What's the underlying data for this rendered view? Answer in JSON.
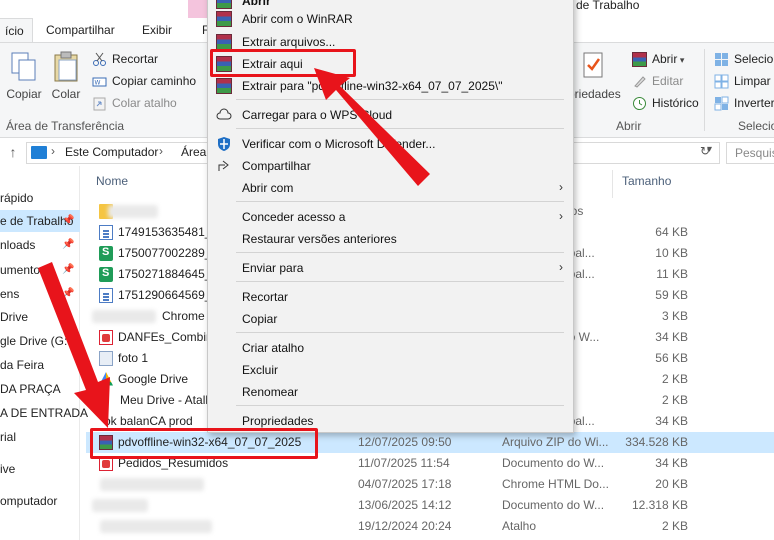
{
  "window": {
    "title": "a de Trabalho"
  },
  "tabs": [
    {
      "label": "ício"
    },
    {
      "label": "Compartilhar"
    },
    {
      "label": "Exibir"
    },
    {
      "label": "F"
    }
  ],
  "ribbon": {
    "copy_label": "Copiar",
    "paste_label": "Colar",
    "cut_label": "Recortar",
    "copy_path_label": "Copiar caminho",
    "paste_shortcut_label": "Colar atalho",
    "group_clipboard": "Área de Transferência",
    "properties_label": "priedades",
    "open_label": "Abrir",
    "edit_label": "Editar",
    "history_label": "Histórico",
    "group_open": "Abrir",
    "select_all_label": "Selecio",
    "clear_selection_label": "Limpar s",
    "invert_label": "Inverter",
    "group_select": "Selecio"
  },
  "address": {
    "path_root": "Este Computador",
    "path_next": "Área",
    "search_placeholder": "Pesquis"
  },
  "nav_pane": {
    "items": [
      {
        "label": " rápido"
      },
      {
        "label": "e de Trabalho"
      },
      {
        "label": "nloads"
      },
      {
        "label": "umentos"
      },
      {
        "label": "ens"
      },
      {
        "label": "Drive"
      },
      {
        "label": "gle Drive (G:"
      },
      {
        "label": "da Feira"
      },
      {
        "label": " DA PRAÇA"
      },
      {
        "label": "A DE ENTRADA"
      },
      {
        "label": "rial"
      },
      {
        "label": "ive"
      },
      {
        "label": "omputador"
      }
    ]
  },
  "columns": {
    "name": "Nome",
    "size": "Tamanho"
  },
  "files": [
    {
      "name": "",
      "date": "",
      "type": "ivos",
      "size": "",
      "icon": "folder-icon"
    },
    {
      "name": "1749153635481_6",
      "date": "",
      "type": "",
      "size": "64 KB",
      "icon": "document-icon"
    },
    {
      "name": "1750077002289_e",
      "date": "",
      "type": "abal...",
      "size": "10 KB",
      "icon": "spreadsheet-icon"
    },
    {
      "name": "1750271884645_9",
      "date": "",
      "type": "abal...",
      "size": "11 KB",
      "icon": "spreadsheet-icon"
    },
    {
      "name": "1751290664569_5",
      "date": "",
      "type": "",
      "size": "59 KB",
      "icon": "document-icon"
    },
    {
      "name": "Chrome",
      "date": "",
      "type": "",
      "size": "3 KB",
      "icon": "shortcut-icon"
    },
    {
      "name": "DANFEs_Combin",
      "date": "",
      "type": "do W...",
      "size": "34 KB",
      "icon": "pdf-icon"
    },
    {
      "name": "foto 1",
      "date": "",
      "type": "",
      "size": "56 KB",
      "icon": "image-icon"
    },
    {
      "name": "Google Drive",
      "date": "",
      "type": "",
      "size": "2 KB",
      "icon": "google-drive-icon"
    },
    {
      "name": "Meu Drive - Atalh",
      "date": "",
      "type": "",
      "size": "2 KB",
      "icon": "shortcut-icon"
    },
    {
      "name": "ok balanCA prod",
      "date": "",
      "type": "abal...",
      "size": "34 KB",
      "icon": "shortcut-icon"
    },
    {
      "name": "pdvoffline-win32-x64_07_07_2025",
      "date": "12/07/2025 09:50",
      "type": "Arquivo ZIP do Wi...",
      "size": "334.528 KB",
      "icon": "winrar-icon"
    },
    {
      "name": "Pedidos_Resumidos",
      "date": "11/07/2025 11:54",
      "type": "Documento do W...",
      "size": "34 KB",
      "icon": "pdf-icon"
    },
    {
      "name": "",
      "date": "04/07/2025 17:18",
      "type": "Chrome HTML Do...",
      "size": "20 KB",
      "icon": "shortcut-icon"
    },
    {
      "name": "",
      "date": "13/06/2025 14:12",
      "type": "Documento do W...",
      "size": "12.318 KB",
      "icon": "shortcut-icon"
    },
    {
      "name": "",
      "date": "19/12/2024 20:24",
      "type": "Atalho",
      "size": "2 KB",
      "icon": "shortcut-icon"
    }
  ],
  "context_menu": {
    "items": [
      {
        "label": "Abrir",
        "icon": "winrar-icon"
      },
      {
        "label": "Abrir com o WinRAR",
        "icon": "winrar-icon"
      },
      {
        "label": "Extrair arquivos...",
        "icon": "winrar-icon"
      },
      {
        "label": "Extrair aqui",
        "icon": "winrar-icon"
      },
      {
        "label": "Extrair para \"pdvoffline-win32-x64_07_07_2025\\\"",
        "icon": "winrar-icon"
      },
      {
        "label": "Carregar para o WPS Cloud",
        "icon": "cloud-icon"
      },
      {
        "label": "Verificar com o Microsoft Defender...",
        "icon": "defender-icon"
      },
      {
        "label": "Compartilhar",
        "icon": "share-icon"
      },
      {
        "label": "Abrir com",
        "icon": ""
      },
      {
        "label": "Conceder acesso a",
        "icon": ""
      },
      {
        "label": "Restaurar versões anteriores",
        "icon": ""
      },
      {
        "label": "Enviar para",
        "icon": ""
      },
      {
        "label": "Recortar",
        "icon": ""
      },
      {
        "label": "Copiar",
        "icon": ""
      },
      {
        "label": "Criar atalho",
        "icon": ""
      },
      {
        "label": "Excluir",
        "icon": ""
      },
      {
        "label": "Renomear",
        "icon": ""
      },
      {
        "label": "Propriedades",
        "icon": ""
      }
    ]
  },
  "colors": {
    "selection": "#cce8ff",
    "highlight": "#e8141b",
    "menu_bg": "#f2f2f2"
  }
}
